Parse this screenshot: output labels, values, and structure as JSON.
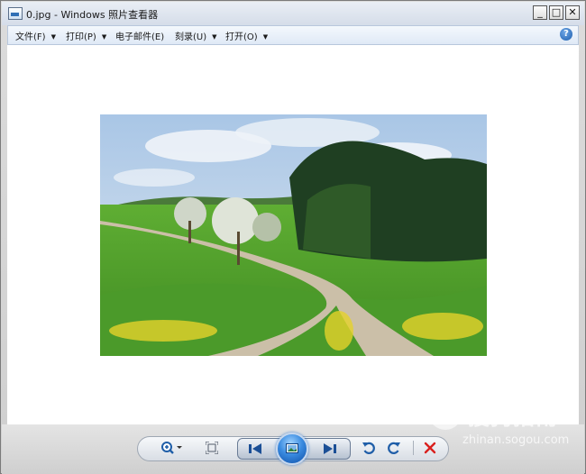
{
  "window": {
    "title": "0.jpg - Windows 照片查看器",
    "controls": {
      "minimize": "_",
      "maximize": "□",
      "close": "✕"
    }
  },
  "menu": {
    "items": [
      {
        "label": "文件(F)",
        "has_dropdown": true
      },
      {
        "label": "打印(P)",
        "has_dropdown": true
      },
      {
        "label": "电子邮件(E)",
        "has_dropdown": false
      },
      {
        "label": "刻录(U)",
        "has_dropdown": true
      },
      {
        "label": "打开(O)",
        "has_dropdown": true
      }
    ],
    "help_icon": "?"
  },
  "photo": {
    "subject": "green meadow with winding dirt road and trees",
    "colors": {
      "sky": "#bcd3ea",
      "grass": "#4f9e2b",
      "forest": "#1f3f22",
      "road": "#cbbfa8",
      "flowers": "#e5d22a"
    }
  },
  "toolbar": {
    "icons": [
      "zoom-icon",
      "fit-window-icon",
      "previous-icon",
      "slideshow-icon",
      "next-icon",
      "rotate-counterclockwise-icon",
      "rotate-clockwise-icon",
      "delete-icon"
    ],
    "accent": "#2f7bd6",
    "delete_color": "#d9201e"
  },
  "watermark": {
    "text": "搜狗指南",
    "url": "zhinan.sogou.com"
  }
}
